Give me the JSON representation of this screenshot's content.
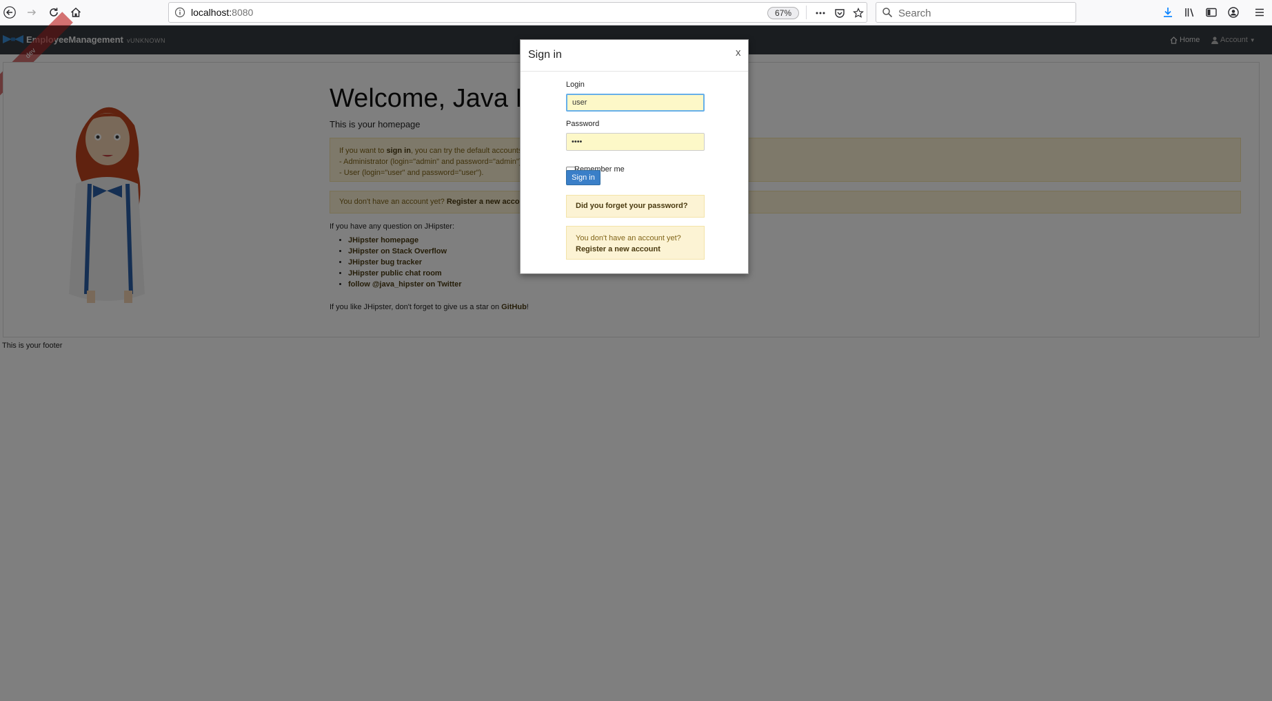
{
  "browser": {
    "url_host": "localhost:",
    "url_port": "8080",
    "zoom": "67%",
    "search_placeholder": "Search"
  },
  "app": {
    "brand": "EmployeeManagement",
    "version": "vUNKNOWN",
    "ribbon": "dev",
    "nav": {
      "home": "Home",
      "account": "Account"
    }
  },
  "home": {
    "title": "Welcome, Java H",
    "lead": "This is your homepage",
    "alert_signin": {
      "prefix": "If you want to ",
      "link": "sign in",
      "suffix": ", you can try the default accounts:",
      "admin_line": "- Administrator (login=\"admin\" and password=\"admin\")",
      "user_line": "- User (login=\"user\" and password=\"user\")."
    },
    "alert_register": {
      "text": "You don't have an account yet? ",
      "link": "Register a new acco"
    },
    "question": "If you have any question on JHipster:",
    "links": [
      "JHipster homepage",
      "JHipster on Stack Overflow",
      "JHipster bug tracker",
      "JHipster public chat room",
      "follow @java_hipster on Twitter"
    ],
    "github": {
      "prefix": "If you like JHipster, don't forget to give us a star on ",
      "link": "GitHub",
      "suffix": "!"
    },
    "footer": "This is your footer"
  },
  "modal": {
    "title": "Sign in",
    "close": "x",
    "login_label": "Login",
    "login_value": "user",
    "password_label": "Password",
    "password_value": "••••",
    "remember_label": "Remember me",
    "submit": "Sign in",
    "forgot": "Did you forget your password?",
    "no_account": "You don't have an account yet?",
    "register": "Register a new account"
  }
}
